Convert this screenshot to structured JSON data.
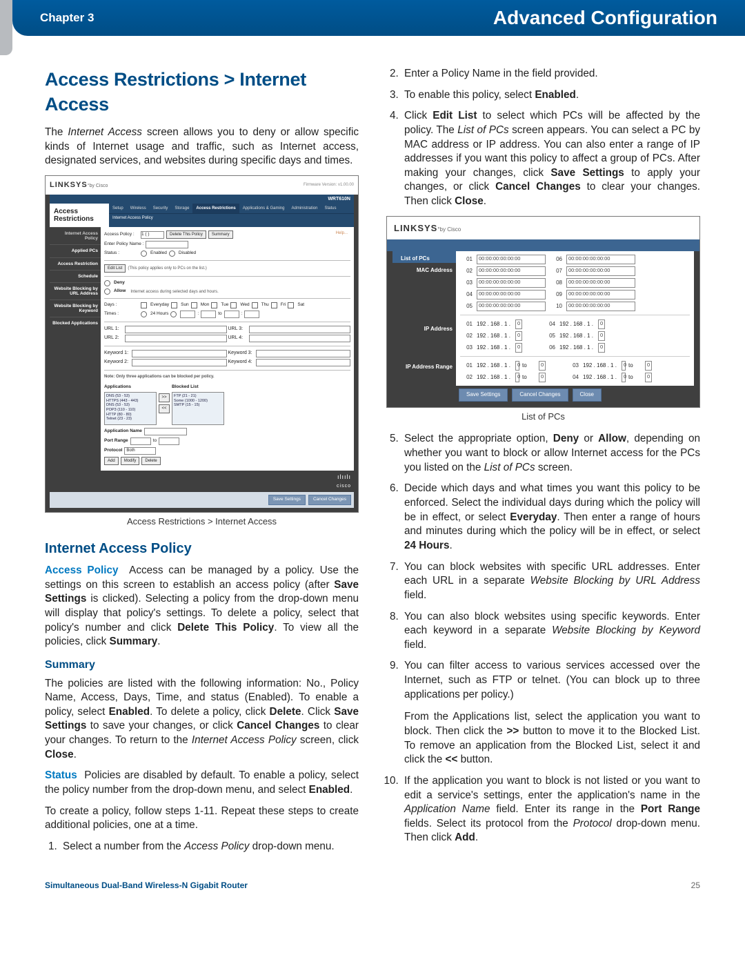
{
  "header": {
    "chapter": "Chapter 3",
    "title": "Advanced Configuration"
  },
  "left": {
    "h2": "Access Restrictions > Internet Access",
    "intro": "The Internet Access screen allows you to deny or allow specific kinds of Internet usage and traffic, such as Internet access, designated services, and websites during specific days and times.",
    "fig1_caption": "Access Restrictions > Internet Access",
    "h3": "Internet Access Policy",
    "accessPolicy_lead": "Access Policy",
    "accessPolicy_body": "  Access can be managed by a policy. Use the settings on this screen to establish an access policy (after Save Settings is clicked). Selecting a policy from the drop-down menu will display that policy's settings. To delete a policy, select that policy's number and click Delete This Policy. To view all the policies, click Summary.",
    "h4": "Summary",
    "summary_body": "The policies are listed with the following information: No., Policy Name, Access, Days, Time, and status (Enabled). To enable a policy, select Enabled. To delete a policy, click Delete. Click Save Settings to save your changes, or click Cancel Changes to clear your changes. To return to the Internet Access Policy screen, click Close.",
    "status_lead": "Status",
    "status_body": "  Policies are disabled by default. To enable a policy, select the policy number from the drop-down menu, and select Enabled.",
    "create_body": "To create a policy, follow steps 1-11. Repeat these steps to create additional policies, one at a time.",
    "step1": "Select a number from the Access Policy drop-down menu."
  },
  "right": {
    "step2": "Enter a Policy Name in the field provided.",
    "step3_pre": "To enable this policy, select ",
    "step3_bold": "Enabled",
    "step4": "Click Edit List to select which PCs will be affected by the policy. The List of PCs screen appears. You can select a PC by MAC address or IP address. You can also enter a range of IP addresses if you want this policy to affect a group of PCs. After making your changes, click Save Settings to apply your changes, or click Cancel Changes to clear your changes. Then click Close.",
    "fig2_caption": "List of PCs",
    "step5": "Select the appropriate option, Deny or Allow, depending on whether you want to block or allow Internet access for the PCs you listed on the List of PCs screen.",
    "step6": "Decide which days and what times you want this policy to be enforced. Select the individual days during which the policy will be in effect, or select Everyday. Then enter a range of hours and minutes during which the policy will be in effect, or select 24 Hours.",
    "step7": "You can block websites with specific URL addresses. Enter each URL in a separate Website Blocking by URL Address field.",
    "step8": "You can also block websites using specific keywords. Enter each keyword in a separate Website Blocking by Keyword field.",
    "step9": "You can filter access to various services accessed over the Internet, such as FTP or telnet. (You can block up to three applications per policy.)",
    "step9b": "From the Applications list, select the application you want to block. Then click the >> button to move it to the Blocked List. To remove an application from the Blocked List, select it and click the << button.",
    "step10": "If the application you want to block is not listed or you want to edit a service's settings, enter the application's name in the Application Name field. Enter its range in the Port Range fields. Select its protocol from the Protocol drop-down menu. Then click Add."
  },
  "shot1": {
    "brand": "LINKSYS",
    "by": "by Cisco",
    "fw": "Firmware Version: v1.00.00",
    "model": "WRT610N",
    "sectionLabel": "Access Restrictions",
    "tabs": [
      "Setup",
      "Wireless",
      "Security",
      "Storage",
      "Access Restrictions",
      "Applications & Gaming",
      "Administration",
      "Status"
    ],
    "subtab": "Internet Access Policy",
    "side": [
      "Internet Access Policy",
      "Applied PCs",
      "Access Restriction",
      "Schedule",
      "Website Blocking by URL Address",
      "Website Blocking by Keyword",
      "Blocked Applications"
    ],
    "form": {
      "accessPolicy": "Access Policy :",
      "apVal": "1 ( )",
      "deleteBtn": "Delete This Policy",
      "summaryBtn": "Summary",
      "enterPolicy": "Enter Policy Name :",
      "status": "Status :",
      "enabled": "Enabled",
      "disabled": "Disabled",
      "editList": "Edit List",
      "editNote": "(This policy applies only to PCs on the list.)",
      "deny": "Deny",
      "allow": "Allow",
      "denyNote": "Internet access during selected days and hours.",
      "days": "Days :",
      "everyday": "Everyday",
      "dayList": [
        "Sun",
        "Mon",
        "Tue",
        "Wed",
        "Thu",
        "Fri",
        "Sat"
      ],
      "times": "Times :",
      "h24": "24 Hours",
      "url": [
        "URL 1:",
        "URL 2:",
        "URL 3:",
        "URL 4:"
      ],
      "kw": [
        "Keyword 1:",
        "Keyword 2:",
        "Keyword 3:",
        "Keyword 4:"
      ],
      "note": "Note: Only three applications can be blocked per policy.",
      "applications": "Applications",
      "blocked": "Blocked List",
      "appList": "DNS (53 - 53)\nHTTPS (443 - 443)\nDNS (53 - 53)\nPOP3 (110 - 110)\nHTTP (80 - 80)\nTelnet (23 - 23)",
      "blkList": "FTP (21 - 21)\nSome (1000 - 1200)\nSMTP (15 - 15)",
      "appName": "Application Name",
      "portRange": "Port Range",
      "to": "to",
      "protocol": "Protocol",
      "both": "Both",
      "add": "Add",
      "modify": "Modify",
      "delete": "Delete",
      "help": "Help...",
      "cisco": "cisco",
      "save": "Save Settings",
      "cancel": "Cancel Changes"
    }
  },
  "shot2": {
    "brand": "LINKSYS",
    "by": "by Cisco",
    "title": "List of PCs",
    "side": [
      "MAC Address",
      "IP Address",
      "IP Address Range"
    ],
    "mac": [
      {
        "n": "01",
        "v": "00:00:00:00:00:00"
      },
      {
        "n": "06",
        "v": "00:00:00:00:00:00"
      },
      {
        "n": "02",
        "v": "00:00:00:00:00:00"
      },
      {
        "n": "07",
        "v": "00:00:00:00:00:00"
      },
      {
        "n": "03",
        "v": "00:00:00:00:00:00"
      },
      {
        "n": "08",
        "v": "00:00:00:00:00:00"
      },
      {
        "n": "04",
        "v": "00:00:00:00:00:00"
      },
      {
        "n": "09",
        "v": "00:00:00:00:00:00"
      },
      {
        "n": "05",
        "v": "00:00:00:00:00:00"
      },
      {
        "n": "10",
        "v": "00:00:00:00:00:00"
      }
    ],
    "ip_prefix": "192 . 168 . 1 .",
    "ip_val": "0",
    "ip_rows": [
      {
        "a": "01",
        "b": "04"
      },
      {
        "a": "02",
        "b": "05"
      },
      {
        "a": "03",
        "b": "06"
      }
    ],
    "range_rows": [
      {
        "a": "01",
        "b": "03"
      },
      {
        "a": "02",
        "b": "04"
      }
    ],
    "to": "to",
    "save": "Save Settings",
    "cancel": "Cancel Changes",
    "close": "Close"
  },
  "footer": {
    "left": "Simultaneous Dual-Band Wireless-N Gigabit Router",
    "right": "25"
  }
}
